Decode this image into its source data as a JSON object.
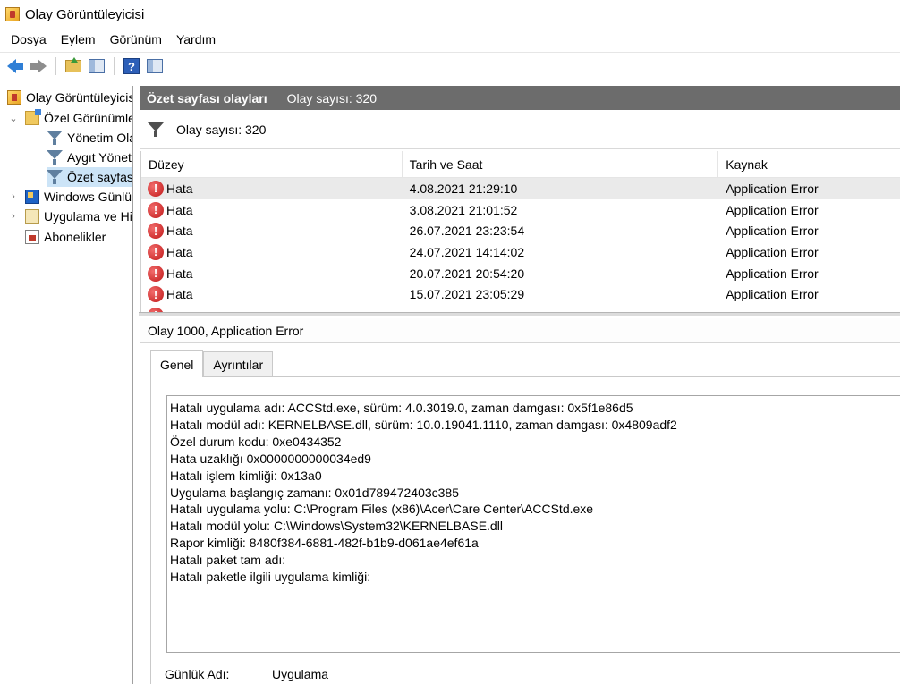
{
  "window": {
    "title": "Olay Görüntüleyicisi"
  },
  "menu": [
    "Dosya",
    "Eylem",
    "Görünüm",
    "Yardım"
  ],
  "toolbar": {
    "icons": [
      "back-arrow-icon",
      "forward-arrow-icon",
      "folder-up-icon",
      "show-hide-pane-icon",
      "help-icon",
      "action-pane-icon"
    ]
  },
  "nav_tree": {
    "root": "Olay Görüntüleyicisi (Yerel)",
    "custom_views": "Özel Görünümler",
    "custom_children": [
      "Yönetim Olayları",
      "Aygıt Yöneticisi",
      "Özet sayfası olayları"
    ],
    "windows_logs": "Windows Günlükleri",
    "app_service_logs": "Uygulama ve Hizmet Günlükleri",
    "subscriptions": "Abonelikler"
  },
  "header": {
    "title": "Özet sayfası olayları",
    "count": "Olay sayısı: 320"
  },
  "filter_bar": {
    "count": "Olay sayısı: 320"
  },
  "events_table": {
    "columns": [
      "Düzey",
      "Tarih ve Saat",
      "Kaynak"
    ],
    "rows": [
      {
        "level": "Hata",
        "datetime": "4.08.2021 21:29:10",
        "source": "Application Error"
      },
      {
        "level": "Hata",
        "datetime": "3.08.2021 21:01:52",
        "source": "Application Error"
      },
      {
        "level": "Hata",
        "datetime": "26.07.2021 23:23:54",
        "source": "Application Error"
      },
      {
        "level": "Hata",
        "datetime": "24.07.2021 14:14:02",
        "source": "Application Error"
      },
      {
        "level": "Hata",
        "datetime": "20.07.2021 20:54:20",
        "source": "Application Error"
      },
      {
        "level": "Hata",
        "datetime": "15.07.2021 23:05:29",
        "source": "Application Error"
      }
    ]
  },
  "detail": {
    "title": "Olay 1000, Application Error",
    "tabs": [
      "Genel",
      "Ayrıntılar"
    ],
    "description_lines": [
      "Hatalı uygulama adı: ACCStd.exe, sürüm: 4.0.3019.0, zaman damgası: 0x5f1e86d5",
      "Hatalı modül adı: KERNELBASE.dll, sürüm: 10.0.19041.1110, zaman damgası: 0x4809adf2",
      "Özel durum kodu: 0xe0434352",
      "Hata uzaklığı 0x0000000000034ed9",
      "Hatalı işlem kimliği: 0x13a0",
      "Uygulama başlangıç zamanı: 0x01d789472403c385",
      "Hatalı uygulama yolu: C:\\Program Files (x86)\\Acer\\Care Center\\ACCStd.exe",
      "Hatalı modül yolu: C:\\Windows\\System32\\KERNELBASE.dll",
      "Rapor kimliği: 8480f384-6881-482f-b1b9-d061ae4ef61a",
      "Hatalı paket tam adı:",
      "Hatalı paketle ilgili uygulama kimliği:"
    ],
    "log_name_label": "Günlük Adı:",
    "log_name_value": "Uygulama"
  }
}
